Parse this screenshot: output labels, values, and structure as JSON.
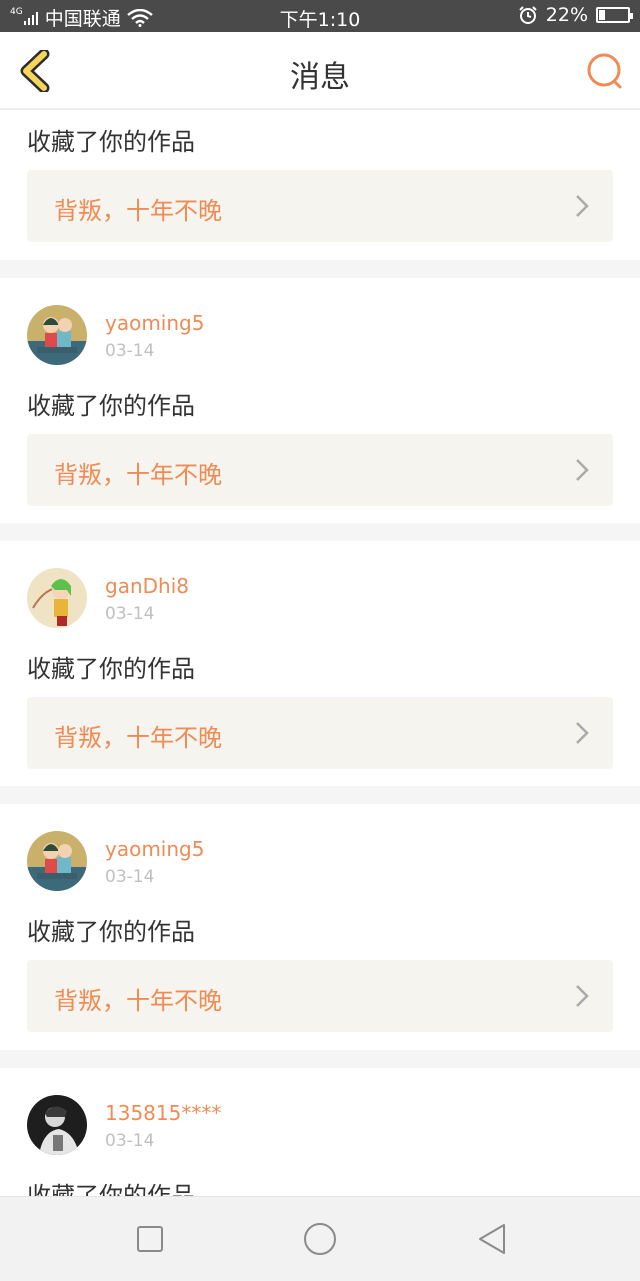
{
  "status_bar": {
    "network": "4G",
    "carrier": "中国联通",
    "time": "下午1:10",
    "battery": "22%",
    "battery_level": 0.22
  },
  "header": {
    "title": "消息",
    "back_icon": "chevron-left-icon",
    "search_icon": "search-icon"
  },
  "colors": {
    "accent": "#f08b55",
    "back_icon_fill": "#f5d65a",
    "work_card_bg": "#f5f4ee",
    "separator": "#f5f5f5"
  },
  "partial_top_item": {
    "action": "收藏了你的作品",
    "work_title": "背叛，十年不晚"
  },
  "messages": [
    {
      "username": "yaoming5",
      "date": "03-14",
      "action": "收藏了你的作品",
      "work_title": "背叛，十年不晚"
    },
    {
      "username": "ganDhi8",
      "date": "03-14",
      "action": "收藏了你的作品",
      "work_title": "背叛，十年不晚"
    },
    {
      "username": "yaoming5",
      "date": "03-14",
      "action": "收藏了你的作品",
      "work_title": "背叛，十年不晚"
    },
    {
      "username": "135815****",
      "date": "03-14",
      "action": "收藏了你的作品"
    }
  ],
  "nav_bar": {
    "recents_icon": "square-icon",
    "home_icon": "circle-icon",
    "back_icon": "triangle-back-icon"
  }
}
